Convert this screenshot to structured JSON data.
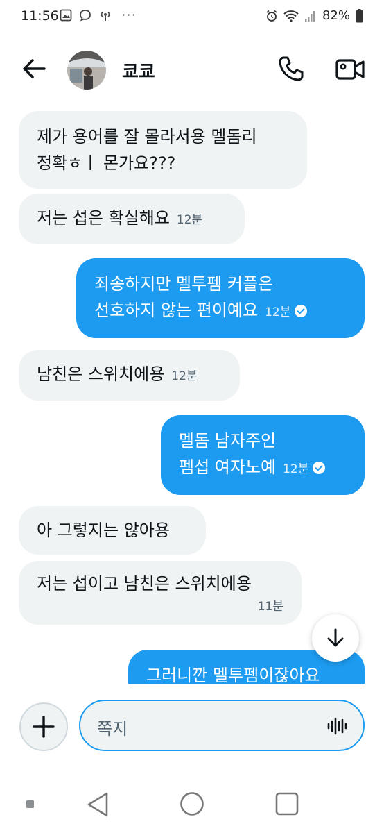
{
  "status_bar": {
    "time": "11:56",
    "dots": "···",
    "battery": "82%"
  },
  "header": {
    "contact_name": "쿄쿄"
  },
  "messages": [
    {
      "side": "received",
      "lines": [
        "제가 용어를 잘 몰라서용 멜돔리",
        "정확ㅎㅣ 몬가요???"
      ],
      "time": ""
    },
    {
      "side": "received",
      "text": "저는 섭은 확실해요",
      "time": "12분"
    },
    {
      "side": "sent",
      "lines": [
        "죄송하지만 멜투펨 커플은",
        "선호하지 않는 편이예요"
      ],
      "time": "12분"
    },
    {
      "side": "received",
      "text": "남친은 스위치에용",
      "time": "12분"
    },
    {
      "side": "sent",
      "lines": [
        "멜돔 남자주인",
        "펨섭 여자노예"
      ],
      "time": "12분"
    },
    {
      "side": "received",
      "text": "아 그렇지는 않아용",
      "time": ""
    },
    {
      "side": "received",
      "text": "저는 섭이고 남친은 스위치에용",
      "time": "11분"
    },
    {
      "side": "sent",
      "text": "그러니깐 멜투펨이잖아요",
      "time": ""
    }
  ],
  "composer": {
    "placeholder": "쪽지"
  },
  "colors": {
    "accent": "#1d9bf0",
    "received_bubble": "#eff3f4"
  }
}
